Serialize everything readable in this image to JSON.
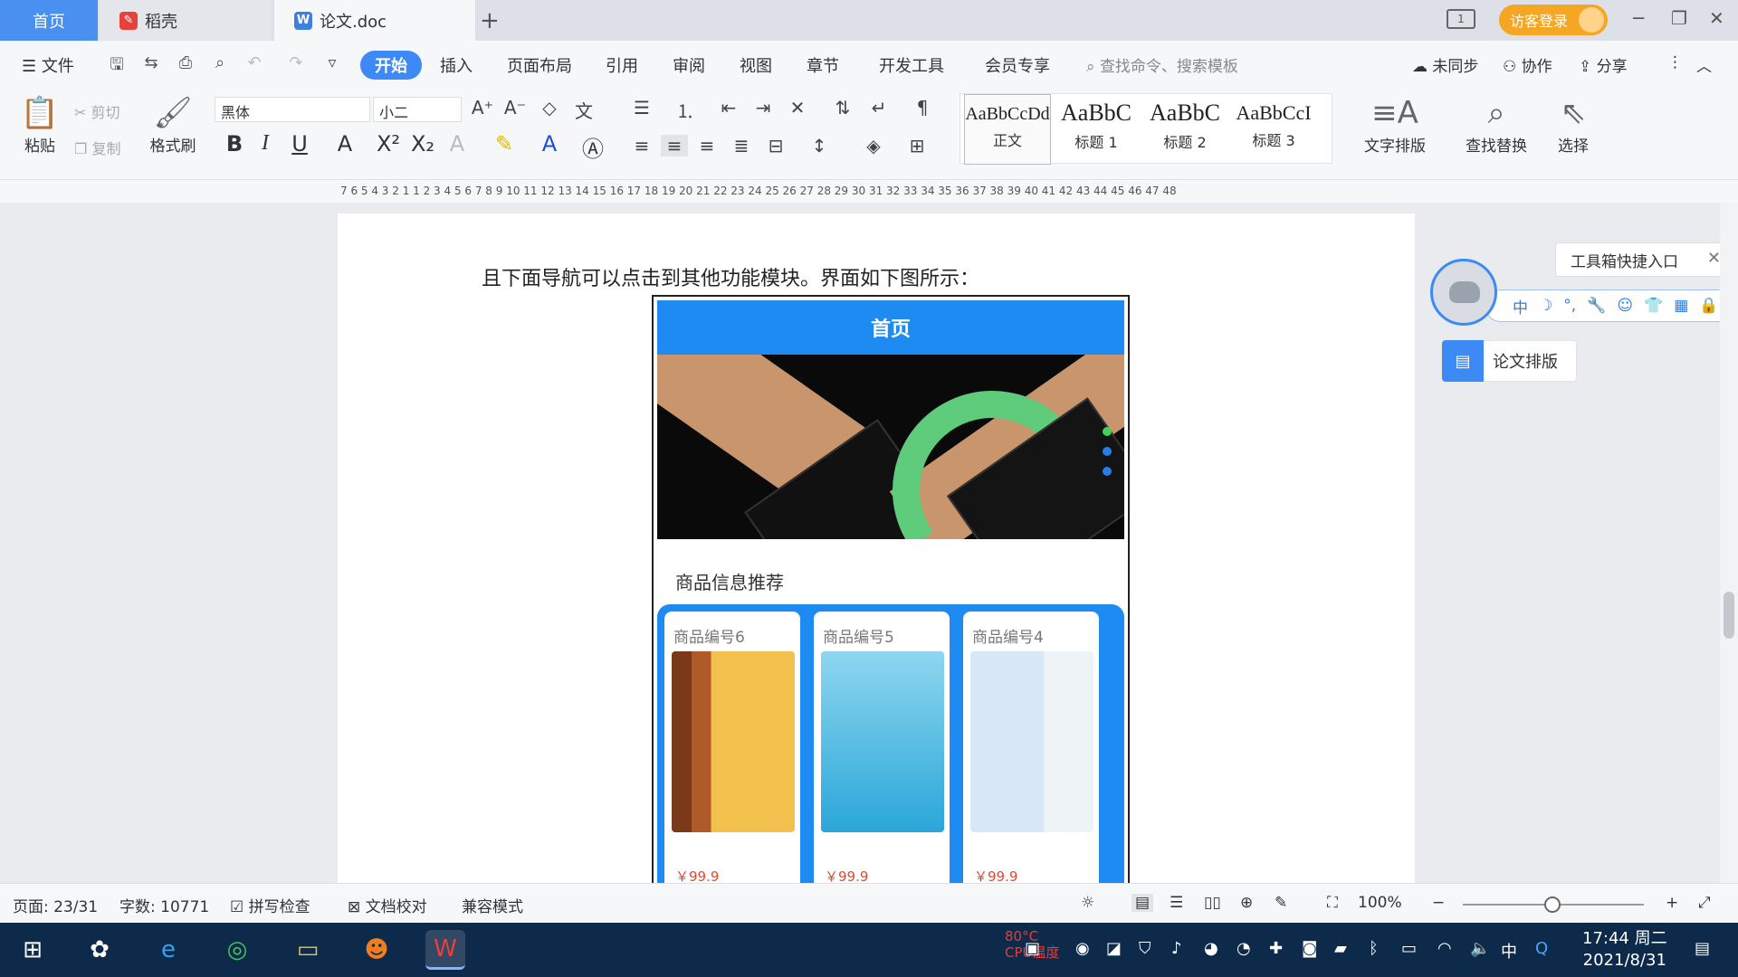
{
  "tabs": {
    "home": "首页",
    "daoke": "稻壳",
    "doc": "论文.doc",
    "add": "+"
  },
  "titlebar": {
    "layout_icon": "1",
    "guest_login": "访客登录",
    "minimize": "─",
    "restore": "❐",
    "close": "✕"
  },
  "menu": {
    "file": "文件",
    "items": [
      "开始",
      "插入",
      "页面布局",
      "引用",
      "审阅",
      "视图",
      "章节",
      "开发工具",
      "会员专享"
    ],
    "search_placeholder": "查找命令、搜索模板",
    "unsynced": "未同步",
    "collab": "协作",
    "share": "分享"
  },
  "ribbon": {
    "paste": "粘贴",
    "cut": "剪切",
    "copy": "复制",
    "format_painter": "格式刷",
    "font_name": "黑体",
    "font_size": "小二",
    "styles": [
      {
        "preview": "AaBbCcDd",
        "name": "正文"
      },
      {
        "preview": "AaBbC",
        "name": "标题 1"
      },
      {
        "preview": "AaBbC",
        "name": "标题 2"
      },
      {
        "preview": "AaBbCcI",
        "name": "标题 3"
      }
    ],
    "text_layout": "文字排版",
    "find_replace": "查找替换",
    "select": "选择"
  },
  "ruler": {
    "text": "7  6  5  4  3  2  1     1  2  3  4  5  6  7  8  9  10 11 12 13 14 15 16 17 18 19 20 21 22 23 24 25 26 27 28 29 30 31 32 33 34 35 36 37 38 39 40 41 42 43 44 45 46 47 48"
  },
  "document": {
    "paragraph": "且下面导航可以点击到其他功能模块。界面如下图所示：",
    "phone": {
      "header": "首页",
      "recommend_title": "商品信息推荐",
      "products": [
        {
          "name": "商品编号6",
          "price": "￥99.9"
        },
        {
          "name": "商品编号5",
          "price": "￥99.9"
        },
        {
          "name": "商品编号4",
          "price": "￥99.9"
        }
      ]
    }
  },
  "side_panel": {
    "toolbox_tip": "工具箱快捷入口",
    "thesis_layout": "论文排版",
    "ime_items": [
      "中",
      "☽",
      "°,",
      "🔧",
      "☺",
      "👕",
      "▦",
      "🔒"
    ]
  },
  "status": {
    "page": "页面: 23/31",
    "words": "字数: 10771",
    "spell_check": "拼写检查",
    "doc_proof": "文档校对",
    "compat_mode": "兼容模式",
    "zoom": "100%",
    "zoom_value": 100
  },
  "taskbar": {
    "cpu_temp": "80°C",
    "cpu_label": "CPU温度",
    "ime_lang": "中",
    "time": "17:44 周二",
    "date": "2021/8/31"
  },
  "colors": {
    "accent": "#3d8af7",
    "guest_login": "#f5a623",
    "phone_header": "#1e8bf3",
    "price": "#e6462e",
    "taskbar": "#0e2a4a"
  }
}
